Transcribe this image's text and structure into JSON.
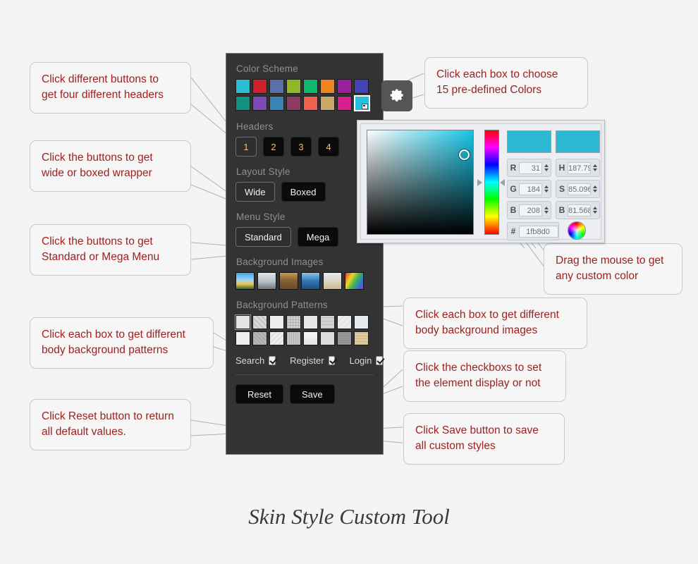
{
  "page": {
    "title": "Skin Style Custom Tool",
    "background": "#f4f4f4"
  },
  "panel": {
    "sections": {
      "color_scheme": "Color Scheme",
      "headers": "Headers",
      "layout_style": "Layout Style",
      "menu_style": "Menu Style",
      "background_images": "Background Images",
      "background_patterns": "Background Patterns"
    },
    "gear_icon": "gear-icon",
    "color_scheme": {
      "row1": [
        "#29bcd4",
        "#cc2229",
        "#5b6fa8",
        "#8fb828",
        "#10b86c",
        "#f2841f",
        "#9c1f9c",
        "#4243b5"
      ],
      "row2": [
        "#11917f",
        "#7a4bb5",
        "#3a83b5",
        "#8f3a63",
        "#f06050",
        "#c9a86a",
        "#d81f8c"
      ],
      "custom_swatch": "#27c0dc"
    },
    "headers": {
      "buttons": [
        "1",
        "2",
        "3",
        "4"
      ],
      "selected": "1"
    },
    "layout_style": {
      "buttons": [
        "Wide",
        "Boxed"
      ],
      "selected": "Wide"
    },
    "menu_style": {
      "buttons": [
        "Standard",
        "Mega"
      ],
      "selected": "Standard"
    },
    "background_images": {
      "count": 6,
      "names": [
        "sky-field",
        "clouds-gray",
        "airplane-runway",
        "blue-water",
        "starfish-beach",
        "colorful-balloons"
      ]
    },
    "background_patterns": {
      "row1": [
        "#e3e3e3",
        "#d8d8d8",
        "#ededed",
        "#cfcfcf",
        "#e6e6e6",
        "#d2d2d2",
        "#ececec",
        "#e4eaee"
      ],
      "row2": [
        "#ededed",
        "#b9b9b9",
        "#f0f0f0",
        "#c6c6c6",
        "#f2f2f2",
        "#dcdcdc",
        "#989898",
        "#e2c99a"
      ],
      "selected_index": 0
    },
    "toggles": [
      {
        "label": "Search",
        "checked": true
      },
      {
        "label": "Register",
        "checked": true
      },
      {
        "label": "Login",
        "checked": true
      }
    ],
    "actions": {
      "reset": "Reset",
      "save": "Save"
    }
  },
  "color_picker": {
    "preview_new": "#2bb8d2",
    "preview_old": "#2bb8d2",
    "fields": {
      "r": {
        "label": "R",
        "value": "31"
      },
      "g": {
        "label": "G",
        "value": "184"
      },
      "b": {
        "label": "B",
        "value": "208"
      },
      "h": {
        "label": "H",
        "value": "187.79"
      },
      "s": {
        "label": "S",
        "value": "85.096"
      },
      "v": {
        "label": "B",
        "value": "81.568"
      },
      "hex": {
        "label": "#",
        "value": "1fb8d0"
      }
    },
    "wheel_icon": "color-wheel-icon"
  },
  "callouts": {
    "headers": {
      "l1": "Click different buttons to",
      "l2": "get four different headers"
    },
    "layout": {
      "l1": "Click the buttons to get",
      "l2": "wide or boxed wrapper"
    },
    "menu": {
      "l1": "Click the buttons to get",
      "l2": "Standard or Mega Menu"
    },
    "patterns": {
      "l1": "Click each box to get different",
      "l2": "body background patterns"
    },
    "reset": {
      "l1": "Click Reset button to return",
      "l2": "all default values."
    },
    "colors": {
      "l1": "Click each box to choose",
      "l2": "15 pre-defined Colors"
    },
    "custom": {
      "l1": "Drag the mouse to get",
      "l2": "any custom color"
    },
    "images": {
      "l1": "Click each box to get different",
      "l2": "body background images"
    },
    "checkbox": {
      "l1": "Click the checkboxs to set",
      "l2": "the element display or not"
    },
    "save": {
      "l1": "Click Save button to save",
      "l2": "all custom styles"
    }
  }
}
